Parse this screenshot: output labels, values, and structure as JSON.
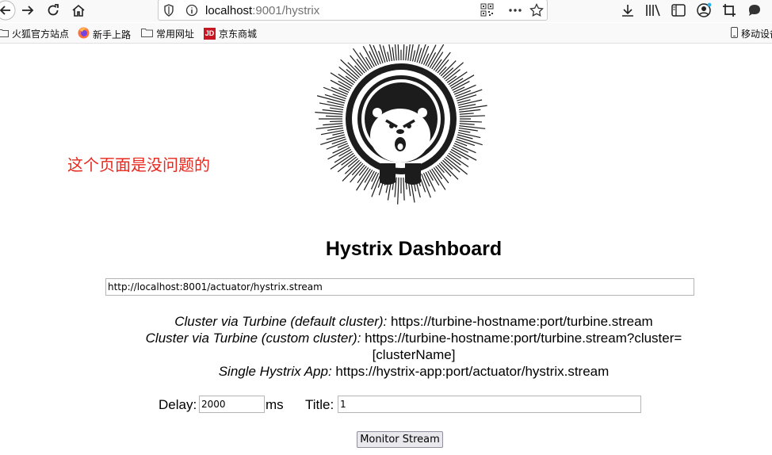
{
  "browser": {
    "url_host": "localhost",
    "url_rest": ":9001/hystrix",
    "bookmarks": [
      {
        "label": "火狐官方站点"
      },
      {
        "label": "新手上路"
      },
      {
        "label": "常用网址"
      },
      {
        "label": "京东商城"
      },
      {
        "label": "移动设备"
      }
    ],
    "jd_logo_text": "JD"
  },
  "page": {
    "annotation": "这个页面是没问题的",
    "title": "Hystrix Dashboard",
    "stream_url": "http://localhost:8001/actuator/hystrix.stream",
    "help": {
      "turbine_default_label": "Cluster via Turbine (default cluster):",
      "turbine_default_value": "https://turbine-hostname:port/turbine.stream",
      "turbine_custom_label": "Cluster via Turbine (custom cluster):",
      "turbine_custom_value": "https://turbine-hostname:port/turbine.stream?cluster=",
      "turbine_custom_value2": "[clusterName]",
      "single_label": "Single Hystrix App:",
      "single_value": "https://hystrix-app:port/actuator/hystrix.stream"
    },
    "delay_label": "Delay:",
    "delay_value": "2000",
    "ms_label": "ms",
    "title_label": "Title:",
    "title_value": "1",
    "monitor_button": "Monitor Stream"
  }
}
